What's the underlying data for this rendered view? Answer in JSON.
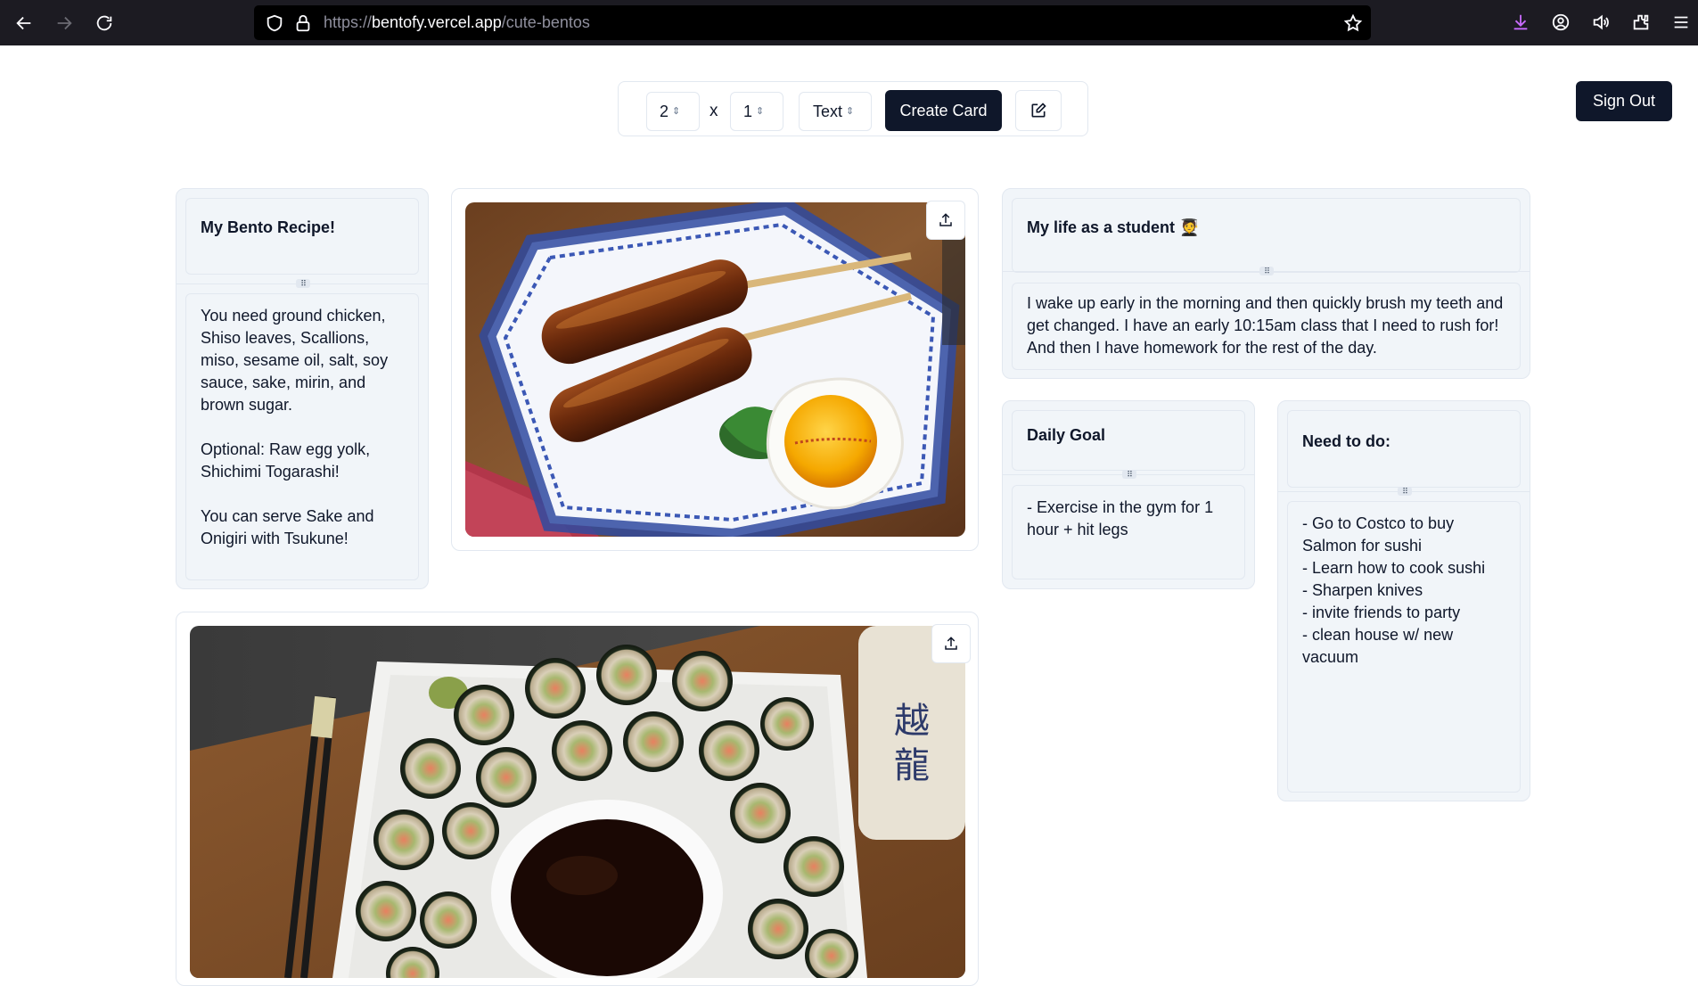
{
  "browser": {
    "url_scheme": "https://",
    "url_host": "bentofy.vercel.app",
    "url_path": "/cute-bentos"
  },
  "toolbar": {
    "width_value": "2",
    "height_value": "1",
    "separator": "x",
    "type_value": "Text",
    "create_label": "Create Card"
  },
  "header": {
    "signout_label": "Sign Out"
  },
  "cards": {
    "recipe": {
      "title": "My Bento Recipe!",
      "body": "You need ground chicken, Shiso leaves, Scallions, miso, sesame oil, salt, soy sauce, sake, mirin, and brown sugar.\n\nOptional: Raw egg yolk, Shichimi Togarashi!\n\nYou can serve Sake  and Onigiri with Tsukune!"
    },
    "student": {
      "title": "My life as a student 🧑‍🎓",
      "body": "I wake up early in the morning and then quickly brush my teeth and get changed. I have an early 10:15am class that I need to rush for! And then I have homework for the rest of the day."
    },
    "goal": {
      "title": "Daily Goal",
      "body": "- Exercise in the gym for 1 hour + hit legs"
    },
    "todo": {
      "title": "Need to do:",
      "body": "- Go to Costco to buy Salmon for sushi\n- Learn how to cook sushi\n- Sharpen knives\n- invite friends to party\n- clean house w/ new vacuum"
    }
  },
  "images": {
    "tsukune": "tsukune-skewers-with-egg-yolk-photo",
    "sushi": "sushi-rolls-with-soy-sauce-photo"
  },
  "colors": {
    "primary": "#0f172a",
    "card_bg": "#f1f5f9",
    "border": "#e2e8f0",
    "chrome_bg": "#1c1b22",
    "download_accent": "#c86bff"
  }
}
